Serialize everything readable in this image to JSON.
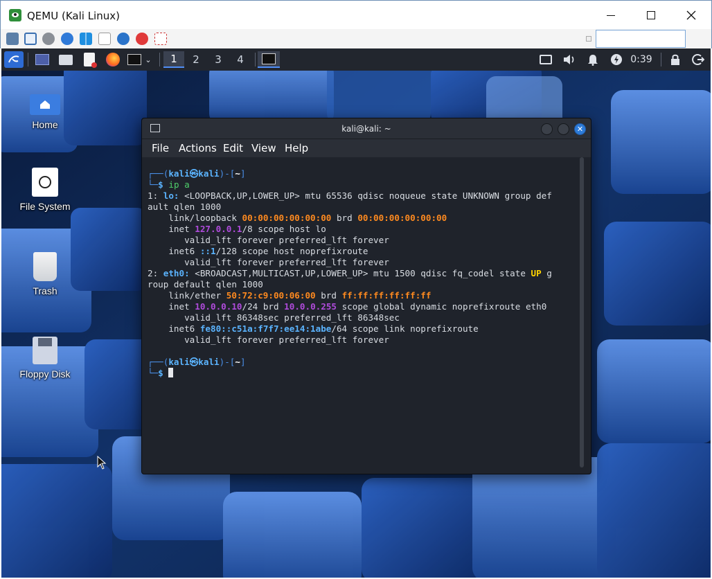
{
  "host": {
    "title": "QEMU (Kali Linux)",
    "search_value": ""
  },
  "panel": {
    "workspaces": [
      "1",
      "2",
      "3",
      "4"
    ],
    "active_workspace": "1",
    "clock": "0:39"
  },
  "desktop": {
    "icons": [
      {
        "label": "Home"
      },
      {
        "label": "File System"
      },
      {
        "label": "Trash"
      },
      {
        "label": "Floppy Disk"
      }
    ]
  },
  "terminal": {
    "title": "kali@kali: ~",
    "menu": [
      "File",
      "Actions",
      "Edit",
      "View",
      "Help"
    ],
    "prompt": {
      "user": "kali",
      "at": "㉿",
      "host": "kali",
      "dir": "~",
      "symbol": "$"
    },
    "command": "ip a",
    "output": {
      "lo_line1_prefix": "1: ",
      "lo_iface": "lo:",
      "lo_line1_rest": " <LOOPBACK,UP,LOWER_UP> mtu 65536 qdisc noqueue state UNKNOWN group def",
      "lo_line1_wrap": "ault qlen 1000",
      "lo_link_prefix": "    link/loopback ",
      "lo_mac": "00:00:00:00:00:00",
      "lo_brd_label": " brd ",
      "lo_brd": "00:00:00:00:00:00",
      "lo_inet_prefix": "    inet ",
      "lo_ip": "127.0.0.1",
      "lo_inet_rest": "/8 scope host lo",
      "lo_valid1": "       valid_lft forever preferred_lft forever",
      "lo_inet6_prefix": "    inet6 ",
      "lo_ip6": "::1",
      "lo_inet6_rest": "/128 scope host noprefixroute",
      "lo_valid2": "       valid_lft forever preferred_lft forever",
      "eth_line1_prefix": "2: ",
      "eth_iface": "eth0:",
      "eth_line1_rest": " <BROADCAST,MULTICAST,UP,LOWER_UP> mtu 1500 qdisc fq_codel state ",
      "eth_state": "UP",
      "eth_line1_end": " g",
      "eth_line1_wrap": "roup default qlen 1000",
      "eth_link_prefix": "    link/ether ",
      "eth_mac": "50:72:c9:00:06:00",
      "eth_brd_label": " brd ",
      "eth_brd": "ff:ff:ff:ff:ff:ff",
      "eth_inet_prefix": "    inet ",
      "eth_ip": "10.0.0.10",
      "eth_inet_mid": "/24 brd ",
      "eth_bcast": "10.0.0.255",
      "eth_inet_rest": " scope global dynamic noprefixroute eth0",
      "eth_valid1": "       valid_lft 86348sec preferred_lft 86348sec",
      "eth_inet6_prefix": "    inet6 ",
      "eth_ip6": "fe80::c51a:f7f7:ee14:1abe",
      "eth_inet6_rest": "/64 scope link noprefixroute",
      "eth_valid2": "       valid_lft forever preferred_lft forever"
    }
  }
}
